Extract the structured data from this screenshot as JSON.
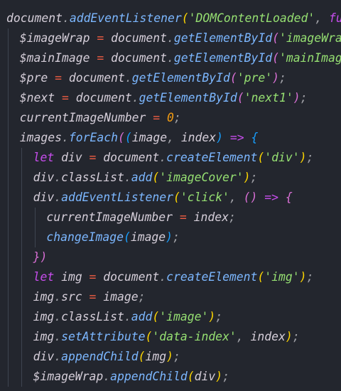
{
  "editor": {
    "language": "javascript",
    "theme_background": "#23262e",
    "lines": [
      {
        "indent": 0,
        "tokens": [
          {
            "t": "document",
            "c": "t-id"
          },
          {
            "t": ".",
            "c": "t-punct"
          },
          {
            "t": "addEventListener",
            "c": "t-method"
          },
          {
            "t": "(",
            "c": "t-paren"
          },
          {
            "t": "'DOMContentLoaded'",
            "c": "t-str"
          },
          {
            "t": ", ",
            "c": "t-punct"
          },
          {
            "t": "func",
            "c": "t-kw"
          }
        ]
      },
      {
        "indent": 1,
        "tokens": [
          {
            "t": "$imageWrap",
            "c": "t-id"
          },
          {
            "t": " = ",
            "c": "t-op"
          },
          {
            "t": "document",
            "c": "t-id"
          },
          {
            "t": ".",
            "c": "t-punct"
          },
          {
            "t": "getElementById",
            "c": "t-method"
          },
          {
            "t": "(",
            "c": "t-paren2"
          },
          {
            "t": "'imageWrap'",
            "c": "t-str"
          }
        ]
      },
      {
        "indent": 1,
        "tokens": [
          {
            "t": "$mainImage",
            "c": "t-id"
          },
          {
            "t": " = ",
            "c": "t-op"
          },
          {
            "t": "document",
            "c": "t-id"
          },
          {
            "t": ".",
            "c": "t-punct"
          },
          {
            "t": "getElementById",
            "c": "t-method"
          },
          {
            "t": "(",
            "c": "t-paren2"
          },
          {
            "t": "'mainImage'",
            "c": "t-str"
          }
        ]
      },
      {
        "indent": 1,
        "tokens": [
          {
            "t": "$pre",
            "c": "t-id"
          },
          {
            "t": " = ",
            "c": "t-op"
          },
          {
            "t": "document",
            "c": "t-id"
          },
          {
            "t": ".",
            "c": "t-punct"
          },
          {
            "t": "getElementById",
            "c": "t-method"
          },
          {
            "t": "(",
            "c": "t-paren2"
          },
          {
            "t": "'pre'",
            "c": "t-str"
          },
          {
            "t": ")",
            "c": "t-paren2"
          },
          {
            "t": ";",
            "c": "t-punct"
          }
        ]
      },
      {
        "indent": 1,
        "tokens": [
          {
            "t": "$next",
            "c": "t-id"
          },
          {
            "t": " = ",
            "c": "t-op"
          },
          {
            "t": "document",
            "c": "t-id"
          },
          {
            "t": ".",
            "c": "t-punct"
          },
          {
            "t": "getElementById",
            "c": "t-method"
          },
          {
            "t": "(",
            "c": "t-paren2"
          },
          {
            "t": "'next1'",
            "c": "t-str"
          },
          {
            "t": ")",
            "c": "t-paren2"
          },
          {
            "t": ";",
            "c": "t-punct"
          }
        ]
      },
      {
        "indent": 1,
        "tokens": [
          {
            "t": "currentImageNumber",
            "c": "t-id"
          },
          {
            "t": " = ",
            "c": "t-op"
          },
          {
            "t": "0",
            "c": "t-num"
          },
          {
            "t": ";",
            "c": "t-punct"
          }
        ]
      },
      {
        "indent": 1,
        "tokens": [
          {
            "t": "images",
            "c": "t-id"
          },
          {
            "t": ".",
            "c": "t-punct"
          },
          {
            "t": "forEach",
            "c": "t-method"
          },
          {
            "t": "(",
            "c": "t-paren2"
          },
          {
            "t": "(",
            "c": "t-paren3"
          },
          {
            "t": "image",
            "c": "t-id"
          },
          {
            "t": ", ",
            "c": "t-punct"
          },
          {
            "t": "index",
            "c": "t-id"
          },
          {
            "t": ")",
            "c": "t-paren3"
          },
          {
            "t": " => ",
            "c": "t-kw"
          },
          {
            "t": "{",
            "c": "t-paren3"
          }
        ]
      },
      {
        "indent": 2,
        "tokens": [
          {
            "t": "let ",
            "c": "t-kw"
          },
          {
            "t": "div",
            "c": "t-id"
          },
          {
            "t": " = ",
            "c": "t-op"
          },
          {
            "t": "document",
            "c": "t-id"
          },
          {
            "t": ".",
            "c": "t-punct"
          },
          {
            "t": "createElement",
            "c": "t-method"
          },
          {
            "t": "(",
            "c": "t-paren"
          },
          {
            "t": "'div'",
            "c": "t-str"
          },
          {
            "t": ")",
            "c": "t-paren"
          },
          {
            "t": ";",
            "c": "t-punct"
          }
        ]
      },
      {
        "indent": 2,
        "tokens": [
          {
            "t": "div",
            "c": "t-id"
          },
          {
            "t": ".",
            "c": "t-punct"
          },
          {
            "t": "classList",
            "c": "t-id"
          },
          {
            "t": ".",
            "c": "t-punct"
          },
          {
            "t": "add",
            "c": "t-method"
          },
          {
            "t": "(",
            "c": "t-paren"
          },
          {
            "t": "'imageCover'",
            "c": "t-str"
          },
          {
            "t": ")",
            "c": "t-paren"
          },
          {
            "t": ";",
            "c": "t-punct"
          }
        ]
      },
      {
        "indent": 2,
        "tokens": [
          {
            "t": "div",
            "c": "t-id"
          },
          {
            "t": ".",
            "c": "t-punct"
          },
          {
            "t": "addEventListener",
            "c": "t-method"
          },
          {
            "t": "(",
            "c": "t-paren"
          },
          {
            "t": "'click'",
            "c": "t-str"
          },
          {
            "t": ", ",
            "c": "t-punct"
          },
          {
            "t": "()",
            "c": "t-paren2"
          },
          {
            "t": " => ",
            "c": "t-kw"
          },
          {
            "t": "{",
            "c": "t-paren2"
          }
        ]
      },
      {
        "indent": 3,
        "tokens": [
          {
            "t": "currentImageNumber",
            "c": "t-id"
          },
          {
            "t": " = ",
            "c": "t-op"
          },
          {
            "t": "index",
            "c": "t-id"
          },
          {
            "t": ";",
            "c": "t-punct"
          }
        ]
      },
      {
        "indent": 3,
        "tokens": [
          {
            "t": "changeImage",
            "c": "t-method"
          },
          {
            "t": "(",
            "c": "t-paren3"
          },
          {
            "t": "image",
            "c": "t-id"
          },
          {
            "t": ")",
            "c": "t-paren3"
          },
          {
            "t": ";",
            "c": "t-punct"
          }
        ]
      },
      {
        "indent": 2,
        "tokens": [
          {
            "t": "})",
            "c": "t-paren2"
          }
        ]
      },
      {
        "indent": 2,
        "tokens": [
          {
            "t": "let ",
            "c": "t-kw"
          },
          {
            "t": "img",
            "c": "t-id"
          },
          {
            "t": " = ",
            "c": "t-op"
          },
          {
            "t": "document",
            "c": "t-id"
          },
          {
            "t": ".",
            "c": "t-punct"
          },
          {
            "t": "createElement",
            "c": "t-method"
          },
          {
            "t": "(",
            "c": "t-paren"
          },
          {
            "t": "'img'",
            "c": "t-str"
          },
          {
            "t": ")",
            "c": "t-paren"
          },
          {
            "t": ";",
            "c": "t-punct"
          }
        ]
      },
      {
        "indent": 2,
        "tokens": [
          {
            "t": "img",
            "c": "t-id"
          },
          {
            "t": ".",
            "c": "t-punct"
          },
          {
            "t": "src",
            "c": "t-id"
          },
          {
            "t": " = ",
            "c": "t-op"
          },
          {
            "t": "image",
            "c": "t-id"
          },
          {
            "t": ";",
            "c": "t-punct"
          }
        ]
      },
      {
        "indent": 2,
        "tokens": [
          {
            "t": "img",
            "c": "t-id"
          },
          {
            "t": ".",
            "c": "t-punct"
          },
          {
            "t": "classList",
            "c": "t-id"
          },
          {
            "t": ".",
            "c": "t-punct"
          },
          {
            "t": "add",
            "c": "t-method"
          },
          {
            "t": "(",
            "c": "t-paren"
          },
          {
            "t": "'image'",
            "c": "t-str"
          },
          {
            "t": ")",
            "c": "t-paren"
          },
          {
            "t": ";",
            "c": "t-punct"
          }
        ]
      },
      {
        "indent": 2,
        "tokens": [
          {
            "t": "img",
            "c": "t-id"
          },
          {
            "t": ".",
            "c": "t-punct"
          },
          {
            "t": "setAttribute",
            "c": "t-method"
          },
          {
            "t": "(",
            "c": "t-paren"
          },
          {
            "t": "'data-index'",
            "c": "t-str"
          },
          {
            "t": ", ",
            "c": "t-punct"
          },
          {
            "t": "index",
            "c": "t-id"
          },
          {
            "t": ")",
            "c": "t-paren"
          },
          {
            "t": ";",
            "c": "t-punct"
          }
        ]
      },
      {
        "indent": 2,
        "tokens": [
          {
            "t": "div",
            "c": "t-id"
          },
          {
            "t": ".",
            "c": "t-punct"
          },
          {
            "t": "appendChild",
            "c": "t-method"
          },
          {
            "t": "(",
            "c": "t-paren"
          },
          {
            "t": "img",
            "c": "t-id"
          },
          {
            "t": ")",
            "c": "t-paren"
          },
          {
            "t": ";",
            "c": "t-punct"
          }
        ]
      },
      {
        "indent": 2,
        "tokens": [
          {
            "t": "$imageWrap",
            "c": "t-id"
          },
          {
            "t": ".",
            "c": "t-punct"
          },
          {
            "t": "appendChild",
            "c": "t-method"
          },
          {
            "t": "(",
            "c": "t-paren"
          },
          {
            "t": "div",
            "c": "t-id"
          },
          {
            "t": ")",
            "c": "t-paren"
          },
          {
            "t": ";",
            "c": "t-punct"
          }
        ]
      }
    ]
  }
}
